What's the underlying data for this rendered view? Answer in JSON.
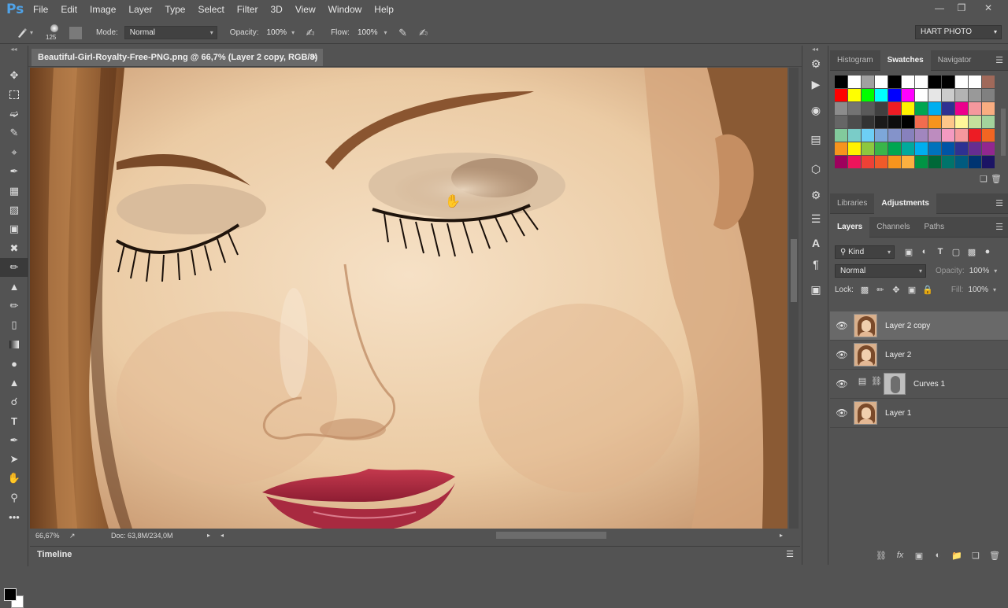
{
  "app": {
    "logo": "Ps"
  },
  "menu": [
    "File",
    "Edit",
    "Image",
    "Layer",
    "Type",
    "Select",
    "Filter",
    "3D",
    "View",
    "Window",
    "Help"
  ],
  "options": {
    "brush_size": "125",
    "mode_label": "Mode:",
    "mode_value": "Normal",
    "opacity_label": "Opacity:",
    "opacity_value": "100%",
    "flow_label": "Flow:",
    "flow_value": "100%",
    "workspace": "HART PHOTO"
  },
  "document": {
    "tab_title": "Beautiful-Girl-Royalty-Free-PNG.png @ 66,7% (Layer 2 copy, RGB/8) *",
    "close": "×",
    "zoom": "66,67%",
    "doc_info": "Doc: 63,8M/234,0M"
  },
  "timeline": {
    "label": "Timeline"
  },
  "top_panel": {
    "tabs": [
      "Histogram",
      "Swatches",
      "Navigator"
    ],
    "active_tab": "Swatches"
  },
  "swatch_colors": [
    "#000000",
    "#ffffff",
    "#a0a0a0",
    "#ffffff",
    "#000000",
    "#ffffff",
    "#ffffff",
    "#000000",
    "#000000",
    "#ffffff",
    "#ffffff",
    "#a0695a",
    "#ff0000",
    "#ffff00",
    "#00ff00",
    "#00ffff",
    "#0000ff",
    "#ff00ff",
    "#ffffff",
    "#e6e6e6",
    "#cccccc",
    "#b3b3b3",
    "#999999",
    "#808080",
    "#8c8c8c",
    "#737373",
    "#5a5a5a",
    "#404040",
    "#ee1c24",
    "#fff200",
    "#00a651",
    "#00aeef",
    "#2e3192",
    "#ec008c",
    "#f5989d",
    "#f9ad81",
    "#666666",
    "#4d4d4d",
    "#333333",
    "#1a1a1a",
    "#0d0d0d",
    "#000000",
    "#f26c4f",
    "#f7941d",
    "#fdc689",
    "#fff799",
    "#c4df9b",
    "#a3d39c",
    "#82ca9c",
    "#7accc8",
    "#6dcff6",
    "#7da7d9",
    "#8493ca",
    "#8781bd",
    "#a186be",
    "#bd8cbf",
    "#f49ac1",
    "#f5989d",
    "#ed1c24",
    "#f26522",
    "#f7941d",
    "#fff200",
    "#8dc73f",
    "#39b54a",
    "#00a651",
    "#00a99d",
    "#00aeef",
    "#0072bc",
    "#0054a6",
    "#2e3192",
    "#662d91",
    "#92278f",
    "#9e005d",
    "#ed145b",
    "#ef4136",
    "#f15a29",
    "#f7941d",
    "#fbb040",
    "#009444",
    "#006838",
    "#00746b",
    "#005b7f",
    "#003471",
    "#1b1464"
  ],
  "adj_panel": {
    "tabs": [
      "Libraries",
      "Adjustments"
    ],
    "active_tab": "Adjustments"
  },
  "layers_panel": {
    "tabs": [
      "Layers",
      "Channels",
      "Paths"
    ],
    "active_tab": "Layers",
    "kind": "Kind",
    "blend_mode": "Normal",
    "opacity_label": "Opacity:",
    "opacity_value": "100%",
    "lock_label": "Lock:",
    "fill_label": "Fill:",
    "fill_value": "100%",
    "layers": [
      {
        "name": "Layer 2 copy",
        "selected": true
      },
      {
        "name": "Layer 2",
        "selected": false
      },
      {
        "name": "Curves 1",
        "selected": false
      },
      {
        "name": "Layer 1",
        "selected": false
      }
    ],
    "footer_icons": [
      "link-icon",
      "fx-icon",
      "mask-icon",
      "adjustment-icon",
      "folder-icon",
      "new-layer-icon",
      "trash-icon"
    ]
  }
}
